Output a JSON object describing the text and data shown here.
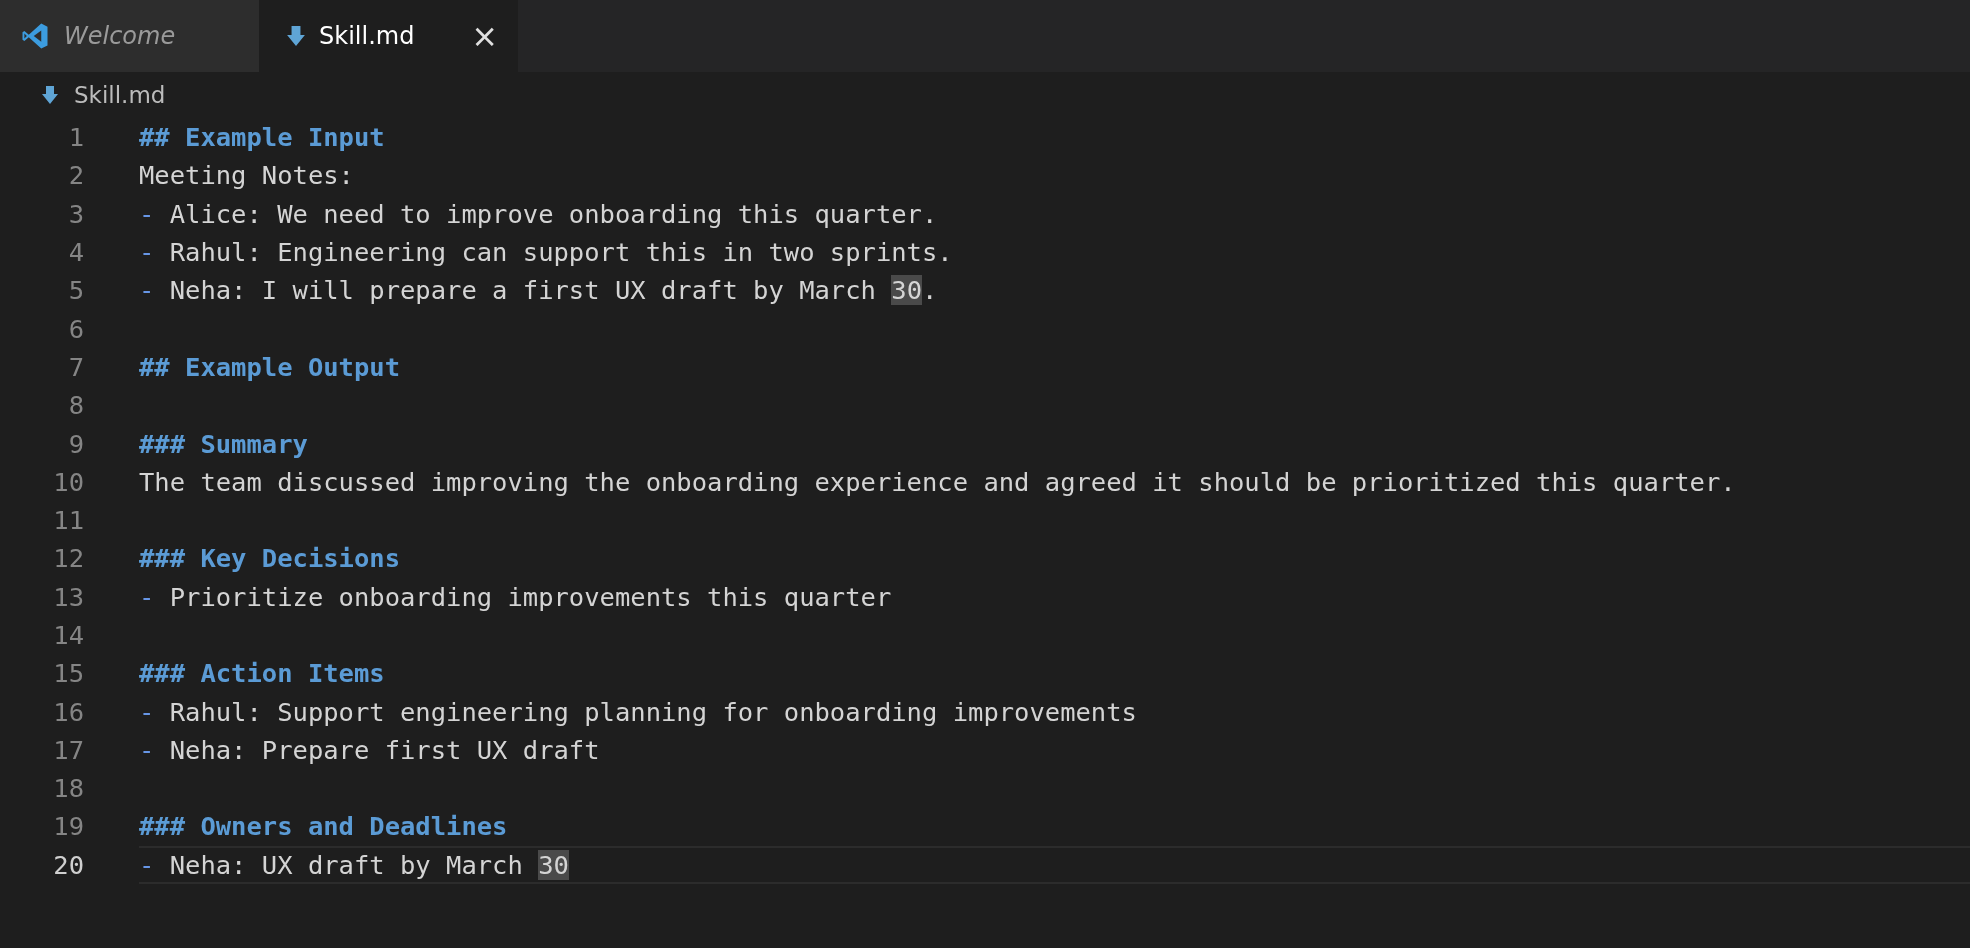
{
  "tabs": [
    {
      "label": "Welcome",
      "kind": "app",
      "selected": false
    },
    {
      "label": "Skill.md",
      "kind": "markdown",
      "selected": true,
      "close": "×"
    }
  ],
  "breadcrumb": {
    "label": "Skill.md"
  },
  "editor": {
    "lines": [
      {
        "number": "1",
        "current": false,
        "tokens": [
          {
            "kind": "heading",
            "text": "## Example Input"
          }
        ]
      },
      {
        "number": "2",
        "current": false,
        "tokens": [
          {
            "kind": "text",
            "text": "Meeting Notes:"
          }
        ]
      },
      {
        "number": "3",
        "current": false,
        "tokens": [
          {
            "kind": "bullet",
            "text": "-"
          },
          {
            "kind": "text",
            "text": " Alice: We need to improve onboarding this quarter."
          }
        ]
      },
      {
        "number": "4",
        "current": false,
        "tokens": [
          {
            "kind": "bullet",
            "text": "-"
          },
          {
            "kind": "text",
            "text": " Rahul: Engineering can support this in two sprints."
          }
        ]
      },
      {
        "number": "5",
        "current": false,
        "tokens": [
          {
            "kind": "bullet",
            "text": "-"
          },
          {
            "kind": "text",
            "text": " Neha: I will prepare a first UX draft by March "
          },
          {
            "kind": "match",
            "text": "30"
          },
          {
            "kind": "text",
            "text": "."
          }
        ]
      },
      {
        "number": "6",
        "current": false
      },
      {
        "number": "7",
        "current": false,
        "tokens": [
          {
            "kind": "heading",
            "text": "## Example Output"
          }
        ]
      },
      {
        "number": "8",
        "current": false
      },
      {
        "number": "9",
        "current": false,
        "tokens": [
          {
            "kind": "heading",
            "text": "### Summary"
          }
        ]
      },
      {
        "number": "10",
        "current": false,
        "tokens": [
          {
            "kind": "text",
            "text": "The team discussed improving the onboarding experience and agreed it should be prioritized this quarter."
          }
        ]
      },
      {
        "number": "11",
        "current": false
      },
      {
        "number": "12",
        "current": false,
        "tokens": [
          {
            "kind": "heading",
            "text": "### Key Decisions"
          }
        ]
      },
      {
        "number": "13",
        "current": false,
        "tokens": [
          {
            "kind": "bullet",
            "text": "-"
          },
          {
            "kind": "text",
            "text": " Prioritize onboarding improvements this quarter"
          }
        ]
      },
      {
        "number": "14",
        "current": false
      },
      {
        "number": "15",
        "current": false,
        "tokens": [
          {
            "kind": "heading",
            "text": "### Action Items"
          }
        ]
      },
      {
        "number": "16",
        "current": false,
        "tokens": [
          {
            "kind": "bullet",
            "text": "-"
          },
          {
            "kind": "text",
            "text": " Rahul: Support engineering planning for onboarding improvements"
          }
        ]
      },
      {
        "number": "17",
        "current": false,
        "tokens": [
          {
            "kind": "bullet",
            "text": "-"
          },
          {
            "kind": "text",
            "text": " Neha: Prepare first UX draft"
          }
        ]
      },
      {
        "number": "18",
        "current": false
      },
      {
        "number": "19",
        "current": false,
        "tokens": [
          {
            "kind": "heading",
            "text": "### Owners and Deadlines"
          }
        ]
      },
      {
        "number": "20",
        "current": true,
        "tokens": [
          {
            "kind": "bullet",
            "text": "-"
          },
          {
            "kind": "text",
            "text": " Neha: UX draft by March "
          },
          {
            "kind": "match",
            "text": "30"
          }
        ]
      }
    ]
  }
}
